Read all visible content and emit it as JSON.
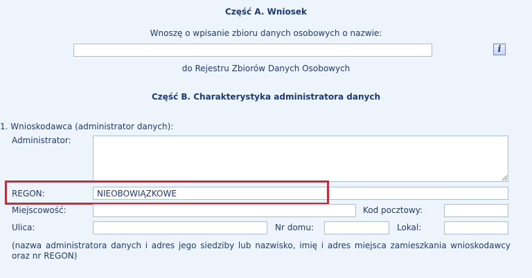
{
  "part_a": {
    "title": "Część A. Wniosek",
    "prompt": "Wnoszę o wpisanie zbioru danych osobowych o nazwie:",
    "dataset_name_value": "",
    "suffix": "do Rejestru Zbiorów Danych Osobowych",
    "info_label": "i"
  },
  "part_b": {
    "title": "Część B. Charakterystyka administratora danych"
  },
  "section1": {
    "heading": "1. Wnioskodawca (administrator danych):",
    "administrator_label": "Administrator:",
    "administrator_value": "",
    "regon_label": "REGON:",
    "regon_value": "NIEOBOWIĄZKOWE",
    "city_label": "Miejscowość:",
    "city_value": "",
    "postal_label": "Kod pocztowy:",
    "postal_value": "",
    "street_label": "Ulica:",
    "street_value": "",
    "house_label": "Nr domu:",
    "house_value": "",
    "apartment_label": "Lokal:",
    "apartment_value": "",
    "note": "(nazwa administratora danych i adres jego siedziby lub nazwisko, imię i adres miejsca zamieszkania wnioskodawcy oraz nr REGON)"
  },
  "colors": {
    "highlight": "#e0212b",
    "text": "#1f3a6e",
    "background": "#eef4fb"
  }
}
